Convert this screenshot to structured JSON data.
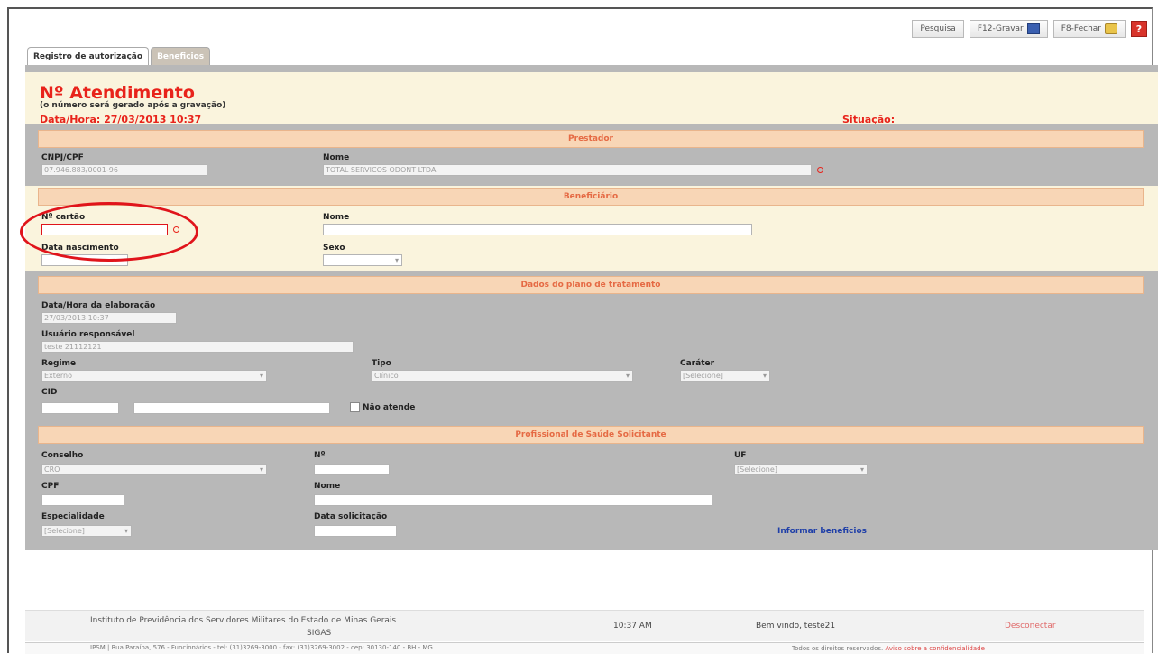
{
  "toolbar": {
    "search_label": "Pesquisa",
    "save_label": "F12-Gravar",
    "close_label": "F8-Fechar",
    "help_label": "?"
  },
  "tabs": [
    {
      "label": "Registro de autorização",
      "active": true
    },
    {
      "label": "Beneficios",
      "active": false
    }
  ],
  "header": {
    "title": "Nº Atendimento",
    "subtitle": "(o número será gerado após a gravação)",
    "datetime_label": "Data/Hora:  27/03/2013 10:37",
    "status_label": "Situação:"
  },
  "prestador": {
    "section_title": "Prestador",
    "cnpj_label": "CNPJ/CPF",
    "cnpj_value": "07.946.883/0001-96",
    "nome_label": "Nome",
    "nome_value": "TOTAL SERVICOS ODONT LTDA"
  },
  "beneficiario": {
    "section_title": "Beneficiário",
    "cartao_label": "Nº cartão",
    "cartao_value": "",
    "nome_label": "Nome",
    "nome_value": "",
    "nascimento_label": "Data nascimento",
    "nascimento_value": "",
    "sexo_label": "Sexo",
    "sexo_value": ""
  },
  "plano": {
    "section_title": "Dados do plano de tratamento",
    "elaboracao_label": "Data/Hora da elaboração",
    "elaboracao_value": "27/03/2013 10:37",
    "usuario_label": "Usuário responsável",
    "usuario_value": "teste 21112121",
    "regime_label": "Regime",
    "regime_value": "Externo",
    "tipo_label": "Tipo",
    "tipo_value": "Clínico",
    "carater_label": "Caráter",
    "carater_value": "[Selecione]",
    "cid_label": "CID",
    "cid_code": "",
    "cid_desc": "",
    "nao_atende_label": "Não atende"
  },
  "profissional": {
    "section_title": "Profissional de Saúde Solicitante",
    "conselho_label": "Conselho",
    "conselho_value": "CRO",
    "numero_label": "Nº",
    "numero_value": "",
    "uf_label": "UF",
    "uf_value": "[Selecione]",
    "cpf_label": "CPF",
    "cpf_value": "",
    "nome_label": "Nome",
    "nome_value": "",
    "especialidade_label": "Especialidade",
    "especialidade_value": "[Selecione]",
    "data_solicitacao_label": "Data solicitação",
    "data_solicitacao_value": "",
    "informar_link": "Informar beneficios"
  },
  "footer": {
    "institution": "Instituto de Previdência dos Servidores Militares do Estado de Minas Gerais",
    "system": "SIGAS",
    "time": "10:37 AM",
    "welcome": "Bem vindo, teste21",
    "logout": "Desconectar",
    "address": "IPSM   |   Rua Paraíba, 576 - Funcionários - tel: (31)3269-3000 - fax: (31)3269-3002 - cep: 30130-140 - BH - MG",
    "rights_prefix": "Todos os direitos reservados.",
    "rights_link": "Aviso sobre a confidencialidade"
  }
}
